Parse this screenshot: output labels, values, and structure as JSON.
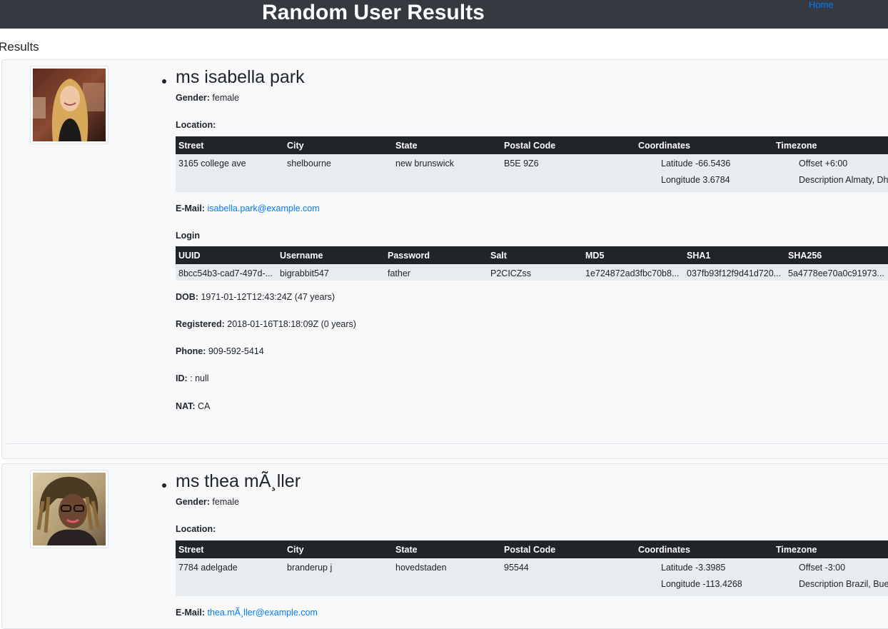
{
  "header": {
    "title": "Random User Results",
    "home_link": "Home"
  },
  "results_heading": "Results",
  "labels": {
    "gender": "Gender:",
    "location": "Location:",
    "email": "E-Mail:",
    "login": "Login",
    "dob": "DOB:",
    "registered": "Registered:",
    "phone": "Phone:",
    "id": "ID:",
    "nat": "NAT:"
  },
  "location_columns": [
    "Street",
    "City",
    "State",
    "Postal Code",
    "Coordinates",
    "Timezone"
  ],
  "login_columns": [
    "UUID",
    "Username",
    "Password",
    "Salt",
    "MD5",
    "SHA1",
    "SHA256"
  ],
  "users": [
    {
      "name": "ms isabella park",
      "gender": "female",
      "location": {
        "street": "3165 college ave",
        "city": "shelbourne",
        "state": "new brunswick",
        "postal_code": "B5E 9Z6",
        "latitude": "Latitude -66.5436",
        "longitude": "Longitude 3.6784",
        "offset": "Offset +6:00",
        "description": "Description Almaty, Dhaka"
      },
      "email": "isabella.park@example.com",
      "login": {
        "uuid": "8bcc54b3-cad7-497d-...",
        "username": "bigrabbit547",
        "password": "father",
        "salt": "P2CICZss",
        "md5": "1e724872ad3fbc70b8...",
        "sha1": "037fb93f12f9d41d720...",
        "sha256": "5a4778ee70a0c91973..."
      },
      "dob": "1971-01-12T12:43:24Z (47 years)",
      "registered": "2018-01-16T18:18:09Z (0 years)",
      "phone": "909-592-5414",
      "id": ": null",
      "nat": "CA"
    },
    {
      "name": "ms thea mÃ¸ller",
      "gender": "female",
      "location": {
        "street": "7784 adelgade",
        "city": "branderup j",
        "state": "hovedstaden",
        "postal_code": "95544",
        "latitude": "Latitude -3.3985",
        "longitude": "Longitude -113.4268",
        "offset": "Offset -3:00",
        "description": "Description Brazil, Buenos Aires"
      },
      "email": "thea.mÃ¸ller@example.com"
    }
  ]
}
